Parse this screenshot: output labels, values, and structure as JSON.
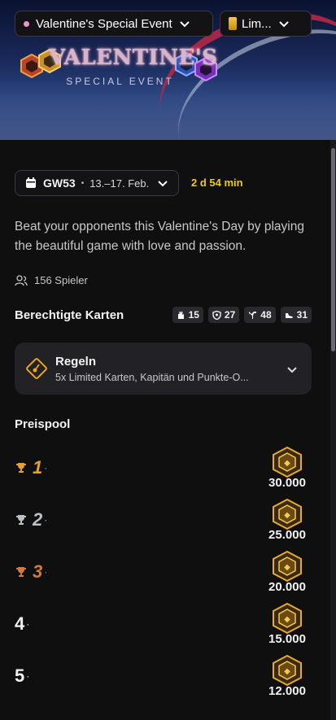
{
  "banner": {
    "title": "VALENTINE'S",
    "subtitle": "SPECIAL EVENT"
  },
  "header": {
    "event_select": "Valentine's Special Event",
    "league_select": "Lim..."
  },
  "gameweek": {
    "label": "GW53",
    "dates": "13.–17. Feb.",
    "countdown": "2 d 54 min"
  },
  "description": "Beat your opponents this Valentine's Day by playing the beautiful game with love and passion.",
  "players": "156 Spieler",
  "eligible": {
    "title": "Berechtigte Karten",
    "counts": [
      {
        "icon": "glove-icon",
        "value": "15"
      },
      {
        "icon": "shield-icon",
        "value": "27"
      },
      {
        "icon": "midfield-icon",
        "value": "48"
      },
      {
        "icon": "boot-icon",
        "value": "31"
      }
    ]
  },
  "rules": {
    "title": "Regeln",
    "summary": "5x Limited Karten, Kapitän und Punkte-O..."
  },
  "prize_pool": {
    "title": "Preispool",
    "places": [
      {
        "rank": "1",
        "medal": "gold",
        "amount": "30.000"
      },
      {
        "rank": "2",
        "medal": "silver",
        "amount": "25.000"
      },
      {
        "rank": "3",
        "medal": "bronze",
        "amount": "20.000"
      },
      {
        "rank": "4",
        "medal": "",
        "amount": "15.000"
      },
      {
        "rank": "5",
        "medal": "",
        "amount": "12.000"
      }
    ]
  },
  "colors": {
    "accent_yellow": "#f2c81e",
    "gold": "#e2a232",
    "silver": "#b9c2c8",
    "bronze": "#d07a3c",
    "background": "#0f0f10"
  }
}
